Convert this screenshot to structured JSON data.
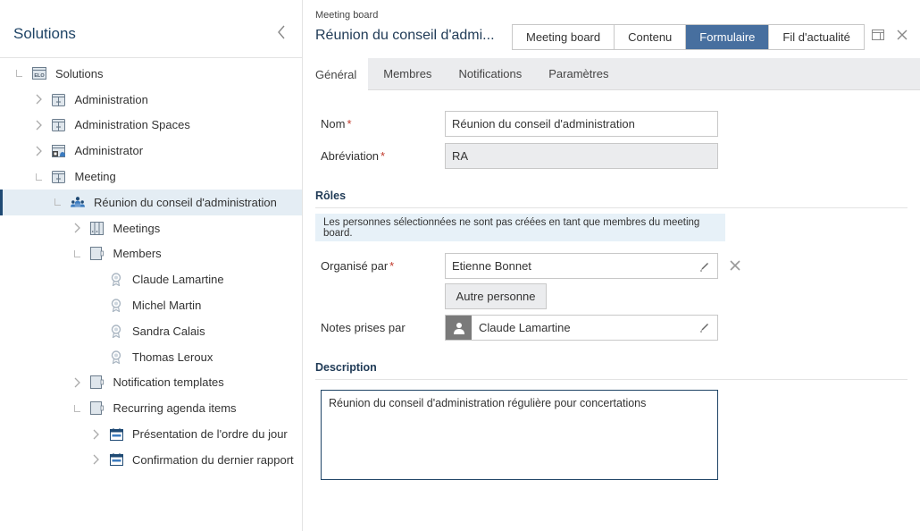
{
  "sidebar": {
    "title": "Solutions",
    "collapse_icon": "chevron-left-icon",
    "tree": [
      {
        "label": "Solutions",
        "level": 0,
        "state": "open",
        "icon": "elo-repository-icon"
      },
      {
        "label": "Administration",
        "level": 1,
        "state": "closed",
        "icon": "cabinet-icon"
      },
      {
        "label": "Administration Spaces",
        "level": 1,
        "state": "closed",
        "icon": "cabinet-icon"
      },
      {
        "label": "Administrator",
        "level": 1,
        "state": "closed",
        "icon": "user-cabinet-icon"
      },
      {
        "label": "Meeting",
        "level": 1,
        "state": "open",
        "icon": "cabinet-icon"
      },
      {
        "label": "Réunion du conseil d'administration",
        "level": 2,
        "state": "open",
        "icon": "meeting-board-icon",
        "selected": true
      },
      {
        "label": "Meetings",
        "level": 3,
        "state": "closed",
        "icon": "binder-icon"
      },
      {
        "label": "Members",
        "level": 3,
        "state": "open",
        "icon": "folder-icon"
      },
      {
        "label": "Claude Lamartine",
        "level": 4,
        "state": "leaf",
        "icon": "member-badge-icon"
      },
      {
        "label": "Michel Martin",
        "level": 4,
        "state": "leaf",
        "icon": "member-badge-icon"
      },
      {
        "label": "Sandra Calais",
        "level": 4,
        "state": "leaf",
        "icon": "member-badge-icon"
      },
      {
        "label": "Thomas Leroux",
        "level": 4,
        "state": "leaf",
        "icon": "member-badge-icon"
      },
      {
        "label": "Notification templates",
        "level": 3,
        "state": "closed",
        "icon": "folder-icon"
      },
      {
        "label": "Recurring agenda items",
        "level": 3,
        "state": "open",
        "icon": "folder-icon"
      },
      {
        "label": "Présentation de l'ordre du jour",
        "level": 4,
        "state": "closed",
        "icon": "agenda-item-icon"
      },
      {
        "label": "Confirmation du dernier rapport",
        "level": 4,
        "state": "closed",
        "icon": "agenda-item-icon"
      }
    ]
  },
  "header": {
    "breadcrumb": "Meeting board",
    "title": "Réunion du conseil d'admi...",
    "view_tabs": [
      {
        "label": "Meeting board",
        "active": false
      },
      {
        "label": "Contenu",
        "active": false
      },
      {
        "label": "Formulaire",
        "active": true
      },
      {
        "label": "Fil d'actualité",
        "active": false
      }
    ]
  },
  "tabs": [
    {
      "label": "Général",
      "active": true
    },
    {
      "label": "Membres",
      "active": false
    },
    {
      "label": "Notifications",
      "active": false
    },
    {
      "label": "Paramètres",
      "active": false
    }
  ],
  "form": {
    "nom": {
      "label": "Nom",
      "required_mark": "*",
      "value": "Réunion du conseil d'administration"
    },
    "abreviation": {
      "label": "Abréviation",
      "required_mark": "*",
      "value": "RA"
    },
    "roles_section": "Rôles",
    "roles_notice": "Les personnes sélectionnées ne sont pas créées en tant que membres du meeting board.",
    "organise_par": {
      "label": "Organisé par",
      "required_mark": "*",
      "value": "Etienne Bonnet"
    },
    "autre_personne_button": "Autre personne",
    "notes_prises_par": {
      "label": "Notes prises par",
      "value": "Claude Lamartine"
    },
    "description_section": "Description",
    "description_value": "Réunion du conseil d'administration régulière pour concertations"
  },
  "colors": {
    "accent": "#476f9f",
    "title": "#1f3a56",
    "selected_row": "#e4edf4",
    "selected_bar": "#1f4a74",
    "required": "#c0392b",
    "notice_bg": "#e7f1f8"
  }
}
